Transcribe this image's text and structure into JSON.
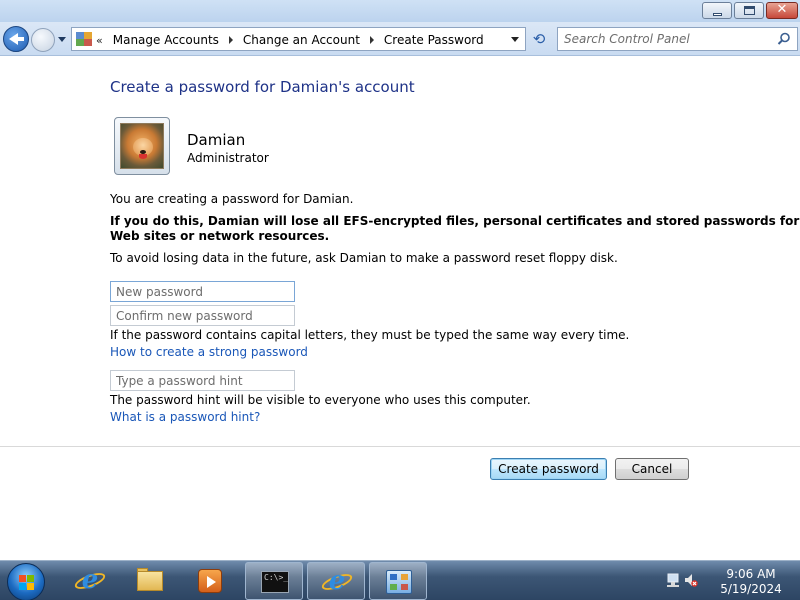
{
  "window": {
    "minimize_label": "",
    "maximize_label": "",
    "close_label": "✕"
  },
  "address_bar": {
    "overflow_chevron": "«",
    "breadcrumbs": [
      {
        "label": "Manage Accounts"
      },
      {
        "label": "Change an Account"
      },
      {
        "label": "Create Password"
      }
    ],
    "refresh_icon": "⟲"
  },
  "search": {
    "placeholder": "Search Control Panel"
  },
  "content": {
    "title": "Create a password for Damian's account",
    "user": {
      "name": "Damian",
      "role": "Administrator"
    },
    "intro": "You are creating a password for Damian.",
    "warning_line1": "If you do this, Damian will lose all EFS-encrypted files, personal certificates and stored passwords for",
    "warning_line2": "Web sites or network resources.",
    "advice": "To avoid losing data in the future, ask Damian to make a password reset floppy disk.",
    "new_password_placeholder": "New password",
    "confirm_password_placeholder": "Confirm new password",
    "case_note": "If the password contains capital letters, they must be typed the same way every time.",
    "strong_password_link": "How to create a strong password",
    "hint_placeholder": "Type a password hint",
    "hint_note": "The password hint will be visible to everyone who uses this computer.",
    "hint_link": "What is a password hint?",
    "create_button": "Create password",
    "cancel_button": "Cancel"
  },
  "taskbar": {
    "items": [
      {
        "icon": "internet-explorer-icon"
      },
      {
        "icon": "file-explorer-icon"
      },
      {
        "icon": "media-player-icon"
      },
      {
        "icon": "command-prompt-icon",
        "text": "C:\\>_"
      },
      {
        "icon": "internet-explorer-icon"
      },
      {
        "icon": "control-panel-icon"
      }
    ],
    "clock": {
      "time": "9:06 AM",
      "date": "5/19/2024"
    }
  },
  "colors": {
    "title_blue": "#1e3287",
    "link_blue": "#1a57b8",
    "taskbar": "#3c5675"
  }
}
